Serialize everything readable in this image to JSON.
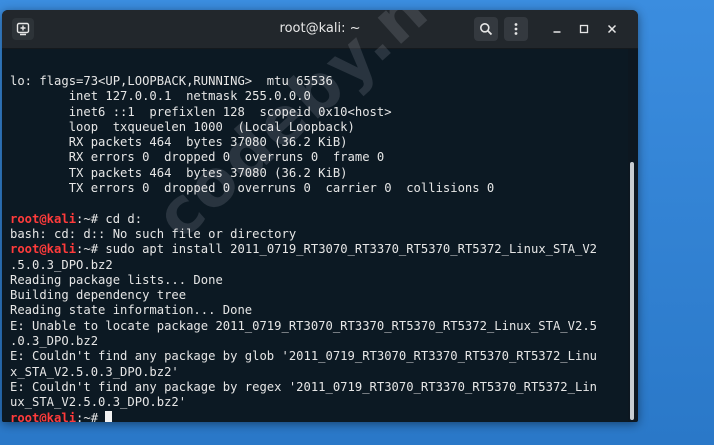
{
  "window": {
    "title": "root@kali: ~"
  },
  "titlebar": {
    "new_tab_icon": "new-tab-icon",
    "search_icon": "search-icon",
    "menu_icon": "kebab-menu-icon",
    "minimize_icon": "minimize-icon",
    "maximize_icon": "maximize-icon",
    "close_icon": "close-icon"
  },
  "colors": {
    "desktop": "#2f7fd1",
    "titlebar": "#22272c",
    "terminal_bg": "#0c1923",
    "prompt_red": "#ff3b3b",
    "text": "#e6e6e6"
  },
  "terminal": {
    "lines": [
      {
        "text": "lo: flags=73<UP,LOOPBACK,RUNNING>  mtu 65536"
      },
      {
        "text": "        inet 127.0.0.1  netmask 255.0.0.0"
      },
      {
        "text": "        inet6 ::1  prefixlen 128  scopeid 0x10<host>"
      },
      {
        "text": "        loop  txqueuelen 1000  (Local Loopback)"
      },
      {
        "text": "        RX packets 464  bytes 37080 (36.2 KiB)"
      },
      {
        "text": "        RX errors 0  dropped 0  overruns 0  frame 0"
      },
      {
        "text": "        TX packets 464  bytes 37080 (36.2 KiB)"
      },
      {
        "text": "        TX errors 0  dropped 0 overruns 0  carrier 0  collisions 0"
      },
      {
        "text": ""
      },
      {
        "prompt": "root@kali",
        "path": ":~# ",
        "text": "cd d:"
      },
      {
        "text": "bash: cd: d:: No such file or directory"
      },
      {
        "prompt": "root@kali",
        "path": ":~# ",
        "text": "sudo apt install 2011_0719_RT3070_RT3370_RT5370_RT5372_Linux_STA_V2"
      },
      {
        "text": ".5.0.3_DPO.bz2"
      },
      {
        "text": "Reading package lists... Done"
      },
      {
        "text": "Building dependency tree"
      },
      {
        "text": "Reading state information... Done"
      },
      {
        "text": "E: Unable to locate package 2011_0719_RT3070_RT3370_RT5370_RT5372_Linux_STA_V2.5"
      },
      {
        "text": ".0.3_DPO.bz2"
      },
      {
        "text": "E: Couldn't find any package by glob '2011_0719_RT3070_RT3370_RT5370_RT5372_Linu"
      },
      {
        "text": "x_STA_V2.5.0.3_DPO.bz2'"
      },
      {
        "text": "E: Couldn't find any package by regex '2011_0719_RT3070_RT3370_RT5370_RT5372_Lin"
      },
      {
        "text": "ux_STA_V2.5.0.3_DPO.bz2'"
      },
      {
        "prompt": "root@kali",
        "path": ":~# ",
        "text": "",
        "cursor": true
      }
    ]
  },
  "watermark": {
    "text": "codeby.net"
  }
}
